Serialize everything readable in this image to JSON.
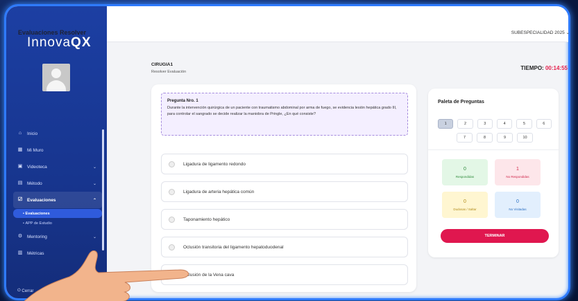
{
  "brand": {
    "name_a": "Innova",
    "name_b": "QX"
  },
  "sidebar": {
    "items": [
      {
        "label": "Inicio",
        "icon": "home-icon"
      },
      {
        "label": "Mi Muro",
        "icon": "wall-icon"
      },
      {
        "label": "Videoteca",
        "icon": "video-icon"
      },
      {
        "label": "Método",
        "icon": "method-icon"
      },
      {
        "label": "Evaluaciones",
        "icon": "check-list-icon"
      },
      {
        "label": "Mentoring",
        "icon": "mentor-icon"
      },
      {
        "label": "Métricas",
        "icon": "chart-icon"
      }
    ],
    "sub_items": [
      "Evaluaciones",
      "APP de Estudio"
    ],
    "logout": "Cerrar"
  },
  "header": {
    "title": "Evaluaciones Resolver",
    "subspecialty": "SUBESPECIALIDAD 2025"
  },
  "exam": {
    "code": "CIRUGIA1",
    "subtitle": "Resolver Evaluación",
    "timer_label": "TIEMPO:",
    "timer_value": "00:14:55"
  },
  "question": {
    "number": "Pregunta Nro. 1",
    "text": "Durante la intervención quirúrgica de un paciente con traumatismo abdominal por arma de fuego, se evidencia lesión hepática grado III, para controlar el sangrado se decide realizar la maniobra de Pringle, ¿En qué consiste?",
    "options": [
      "Ligadura de ligamento redondo",
      "Ligadura de arteria hepática común",
      "Taponamiento hepático",
      "Oclusión transitoria del ligamento hepatoduodenal",
      "Oclusión de la Vena cava"
    ]
  },
  "palette": {
    "title": "Paleta de Preguntas",
    "row1": [
      "1",
      "2",
      "3",
      "4",
      "5",
      "6"
    ],
    "row2": [
      "7",
      "8",
      "9",
      "10"
    ],
    "stats": {
      "answered": {
        "count": "0",
        "label": "Respondidas"
      },
      "unanswered": {
        "count": "1",
        "label": "No Respondidas"
      },
      "doubtful": {
        "count": "0",
        "label": "Dudosas / Saltar"
      },
      "visited": {
        "count": "0",
        "label": "No Visitadas"
      }
    },
    "finish_label": "TERMINAR"
  },
  "colors": {
    "sidebar": "#1c3fa3",
    "accent": "#e0174f",
    "frame": "#2f7bff"
  }
}
